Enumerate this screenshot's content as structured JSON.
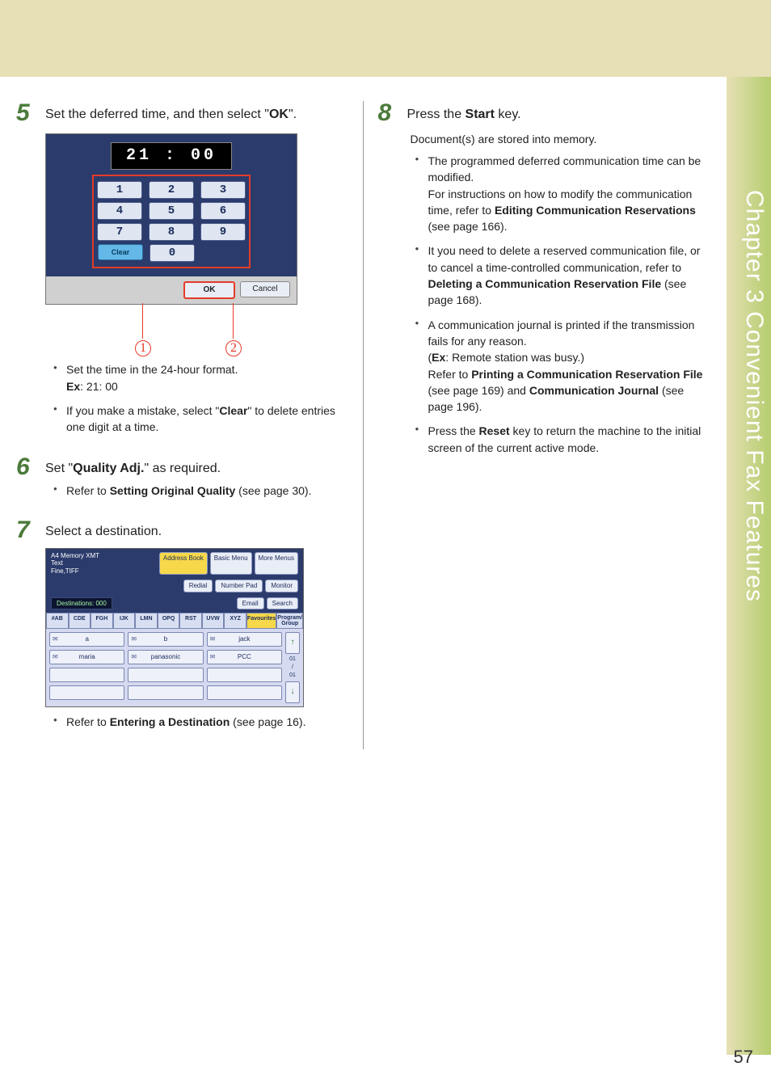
{
  "side_tab": "Chapter 3    Convenient Fax Features",
  "page_number": "57",
  "left": {
    "step5": {
      "num": "5",
      "text_a": "Set the deferred time, and then select \"",
      "text_ok": "OK",
      "text_b": "\".",
      "time_display": "21 : 00",
      "keys": {
        "k1": "1",
        "k2": "2",
        "k3": "3",
        "k4": "4",
        "k5": "5",
        "k6": "6",
        "k7": "7",
        "k8": "8",
        "k9": "9",
        "k0": "0"
      },
      "clear": "Clear",
      "ok_btn": "OK",
      "cancel_btn": "Cancel",
      "callout1": "1",
      "callout2": "2",
      "b1_a": "Set the time in the 24-hour format.",
      "b1_ex_label": "Ex",
      "b1_ex_val": ": 21: 00",
      "b2_a": "If you make a mistake, select \"",
      "b2_clear": "Clear",
      "b2_b": "\" to delete entries one digit at a time."
    },
    "step6": {
      "num": "6",
      "text_a": "Set \"",
      "text_q": "Quality Adj.",
      "text_b": "\" as required.",
      "b1_a": "Refer to ",
      "b1_bold": "Setting Original Quality",
      "b1_b": " (see page 30)."
    },
    "step7": {
      "num": "7",
      "text": "Select a destination.",
      "hdr_left1": "A4        Memory XMT",
      "hdr_left2": "Text",
      "hdr_left3": "Fine,TIFF",
      "tab_addr": "Address Book",
      "tab_basic": "Basic Menu",
      "tab_more": "More Menus",
      "btn_redial": "Redial",
      "btn_numpad": "Number Pad",
      "btn_monitor": "Monitor",
      "dest_label": "Destinations: 000",
      "btn_email": "Email",
      "btn_search": "Search",
      "letters": [
        "#AB",
        "CDE",
        "FGH",
        "IJK",
        "LMN",
        "OPQ",
        "RST",
        "UVW",
        "XYZ",
        "Favourites",
        "Program/\nGroup"
      ],
      "cells": [
        "a",
        "b",
        "jack",
        "maria",
        "panasonic",
        "PCC"
      ],
      "page_ind": "01\n/\n01",
      "b1_a": "Refer to ",
      "b1_bold": "Entering a Destination",
      "b1_b": " (see page 16)."
    }
  },
  "right": {
    "step8": {
      "num": "8",
      "text_a": "Press the ",
      "text_start": "Start",
      "text_b": " key.",
      "sub": "Document(s) are stored into memory.",
      "b1_a": "The programmed deferred communication time can be modified.",
      "b1_b": "For instructions on how to modify the communication time, refer to ",
      "b1_bold": "Editing Communication Reservations",
      "b1_c": " (see page 166).",
      "b2_a": "It you need to delete a reserved communication file, or to cancel a time-controlled communication, refer to ",
      "b2_bold": "Deleting a Communication Reservation File",
      "b2_b": " (see page 168).",
      "b3_a": "A communication journal is printed if the transmission fails for any reason.",
      "b3_ex": " (",
      "b3_exlbl": "Ex",
      "b3_exval": ": Remote station was busy.)",
      "b3_b": "Refer to ",
      "b3_bold1": "Printing a Communication Reservation File",
      "b3_c": " (see page 169) and ",
      "b3_bold2": "Communication Journal",
      "b3_d": " (see page 196).",
      "b4_a": "Press the ",
      "b4_bold": "Reset",
      "b4_b": " key to return the machine to the initial screen of the current active mode."
    }
  }
}
